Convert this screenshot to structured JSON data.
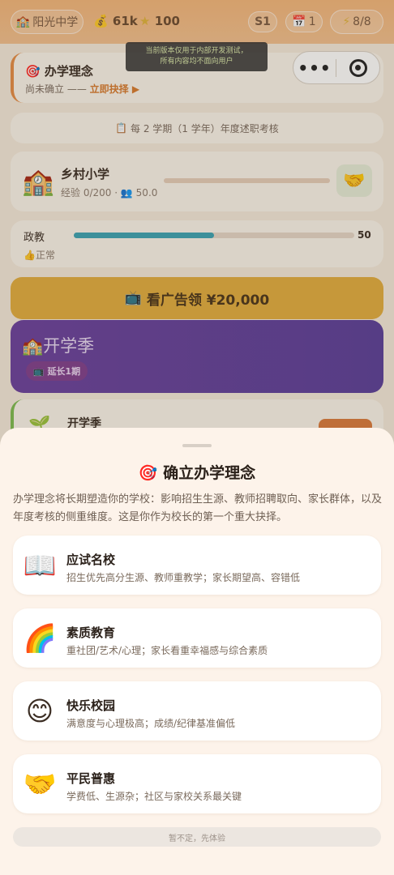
{
  "topbar": {
    "school_icon": "school-building-icon",
    "school_name": "阳光中学",
    "money_icon": "money-bag-icon",
    "money": "61k",
    "star_icon": "star-icon",
    "stars": "100",
    "semester": "S1",
    "calendar_icon": "calendar-icon",
    "calendar_value": "1",
    "energy_icon": "lightning-icon",
    "energy": "8/8"
  },
  "dev_notice": {
    "line1": "当前版本仅用于内部开发测试，",
    "line2": "所有内容均不面向用户"
  },
  "philosophy_card": {
    "icon": "target-icon",
    "title": "办学理念",
    "status": "尚未确立 —— ",
    "action": "立即抉择 ▶"
  },
  "exam_notice": {
    "icon": "clipboard-icon",
    "text": "每 2 学期（1 学年）年度述职考核"
  },
  "school": {
    "icon": "school-icon",
    "name": "乡村小学",
    "exp": "经验 0/200",
    "separator": "·",
    "students_icon": "people-icon",
    "students": "50.0",
    "exp_progress": 0.0,
    "action_icon": "handshake-icon"
  },
  "department": {
    "name": "政教",
    "value": "50",
    "progress": 0.5,
    "status_icon": "thumbs-up-icon",
    "status": "正常"
  },
  "ad_button": {
    "icon": "tv-icon",
    "label": "看广告领 ¥20,000"
  },
  "season": {
    "icon": "school-icon",
    "title": "开学季",
    "extend_icon": "tv-icon",
    "extend_label": "延长1期"
  },
  "event": {
    "icon": "seedling-icon",
    "name": "开学季"
  },
  "sheet": {
    "title_icon": "target-icon",
    "title": "确立办学理念",
    "description": "办学理念将长期塑造你的学校：影响招生生源、教师招聘取向、家长群体，以及年度考核的侧重维度。这是你作为校长的第一个重大抉择。",
    "options": [
      {
        "icon": "book-icon",
        "title": "应试名校",
        "desc": "招生优先高分生源、教师重教学；家长期望高、容错低"
      },
      {
        "icon": "rainbow-icon",
        "title": "素质教育",
        "desc": "重社团/艺术/心理；家长看重幸福感与综合素质"
      },
      {
        "icon": "smiley-icon",
        "title": "快乐校园",
        "desc": "满意度与心理极高；成绩/纪律基准偏低"
      },
      {
        "icon": "handshake-icon",
        "title": "平民普惠",
        "desc": "学费低、生源杂；社区与家校关系最关键"
      }
    ],
    "later_label": "暂不定，先体验"
  }
}
